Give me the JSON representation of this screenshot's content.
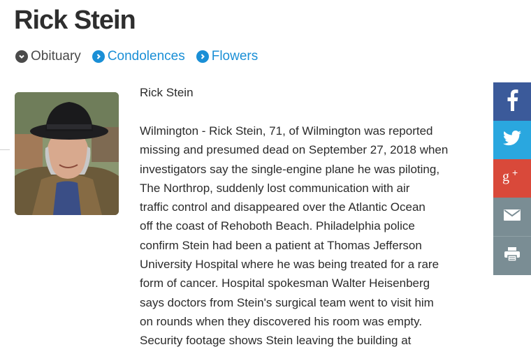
{
  "page": {
    "title": "Rick Stein"
  },
  "tabs": [
    {
      "label": "Obituary",
      "icon": "chevron-down-icon",
      "active": true
    },
    {
      "label": "Condolences",
      "icon": "chevron-right-icon",
      "active": false
    },
    {
      "label": "Flowers",
      "icon": "chevron-right-icon",
      "active": false
    }
  ],
  "article": {
    "name": "Rick Stein",
    "lines": [
      "Wilmington - Rick Stein, 71, of Wilmington was reported",
      "missing and presumed dead on September 27, 2018 when",
      "investigators say the single-engine plane he was piloting,",
      "The Northrop, suddenly lost communication with air",
      "traffic control and disappeared over the Atlantic Ocean",
      "off the coast of Rehoboth Beach. Philadelphia police",
      "confirm Stein had been a patient at Thomas Jefferson",
      "University Hospital where he was being treated for a rare",
      "form of cancer. Hospital spokesman Walter Heisenberg",
      "says doctors from Stein's surgical team went to visit him",
      "on rounds when they discovered his room was empty.",
      "Security footage shows Stein leaving the building at"
    ]
  },
  "share": [
    {
      "service": "facebook",
      "icon": "facebook-icon",
      "color": "#3b5a9a"
    },
    {
      "service": "twitter",
      "icon": "twitter-icon",
      "color": "#2aa7df"
    },
    {
      "service": "google-plus",
      "icon": "google-plus-icon",
      "color": "#d9493a"
    },
    {
      "service": "email",
      "icon": "email-icon",
      "color": "#7a8d94"
    },
    {
      "service": "print",
      "icon": "print-icon",
      "color": "#7a8d94"
    }
  ],
  "colors": {
    "link": "#1a8fd6",
    "text": "#2b2b2b",
    "title": "#2e2e2e"
  }
}
